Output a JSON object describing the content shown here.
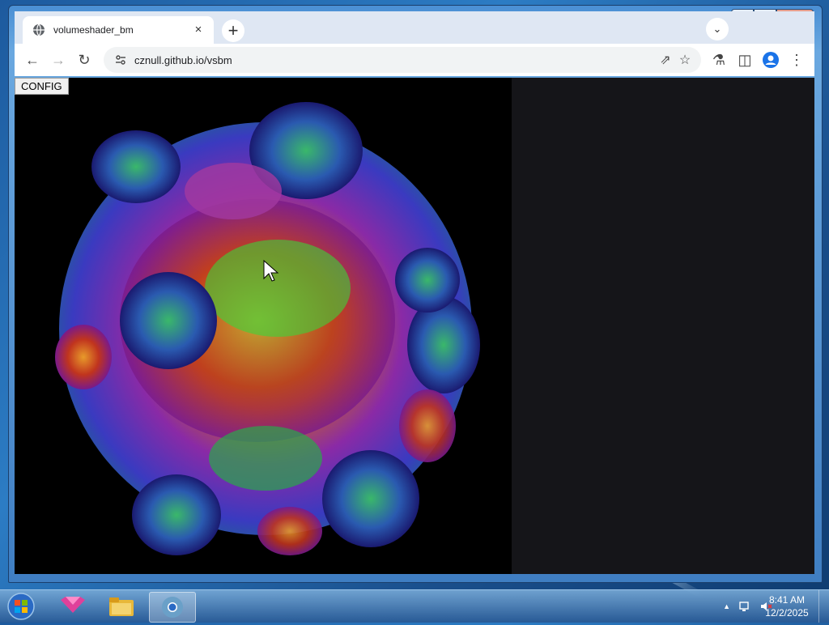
{
  "window": {
    "minimize": "—",
    "maximize": "❐",
    "close": "✕"
  },
  "tab": {
    "title": "volumeshader_bm",
    "close": "×",
    "new_tab": "+",
    "tab_search": "⌄"
  },
  "toolbar": {
    "back": "←",
    "forward": "→",
    "reload": "↻",
    "url": "cznull.github.io/vsbm",
    "share": "⇗",
    "bookmark": "☆",
    "labs": "⚗",
    "side_panel": "◫",
    "menu": "⋮"
  },
  "page": {
    "config_label": "CONFIG"
  },
  "taskbar": {
    "apps": [
      "start-orb",
      "app-pink",
      "file-explorer",
      "chrome"
    ],
    "tray_arrow": "▲",
    "clock_time": "8:41 AM",
    "clock_date": "12/2/2025"
  },
  "colors": {
    "accent": "#2c7cc4",
    "canvas_bg": "#000000",
    "side_bg": "#151519"
  }
}
